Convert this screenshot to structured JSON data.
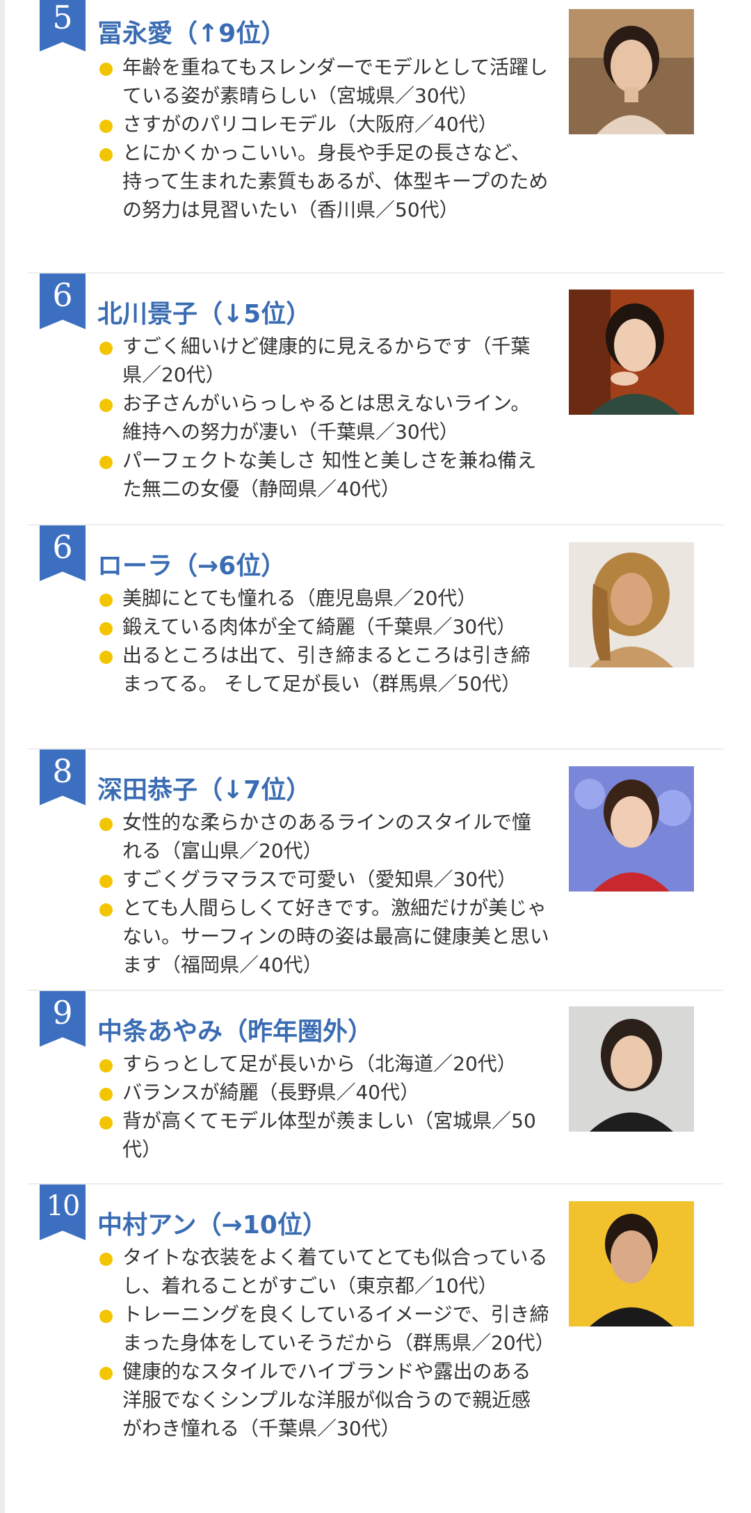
{
  "entries": [
    {
      "rank": "5",
      "name": "冨永愛（↑9位）",
      "comments": [
        "年齢を重ねてもスレンダーでモデルとして活躍している姿が素晴らしい（宮城県／30代）",
        "さすがのパリコレモデル（大阪府／40代）",
        "とにかくかっこいい。身長や手足の長さなど、持って生まれた素質もあるが、体型キープのための努力は見習いたい（香川県／50代）"
      ]
    },
    {
      "rank": "6",
      "name": "北川景子（↓5位）",
      "comments": [
        "すごく細いけど健康的に見えるからです（千葉県／20代）",
        "お子さんがいらっしゃるとは思えないライン。維持への努力が凄い（千葉県／30代）",
        "パーフェクトな美しさ 知性と美しさを兼ね備えた無二の女優（静岡県／40代）"
      ]
    },
    {
      "rank": "6",
      "name": "ローラ（→6位）",
      "comments": [
        "美脚にとても憧れる（鹿児島県／20代）",
        "鍛えている肉体が全て綺麗（千葉県／30代）",
        "出るところは出て、引き締まるところは引き締まってる。 そして足が長い（群馬県／50代）"
      ]
    },
    {
      "rank": "8",
      "name": "深田恭子（↓7位）",
      "comments": [
        "女性的な柔らかさのあるラインのスタイルで憧れる（富山県／20代）",
        "すごくグラマラスで可愛い（愛知県／30代）",
        "とても人間らしくて好きです。激細だけが美じゃない。サーフィンの時の姿は最高に健康美と思います（福岡県／40代）"
      ]
    },
    {
      "rank": "9",
      "name": "中条あやみ（昨年圏外）",
      "comments": [
        "すらっとして足が長いから（北海道／20代）",
        "バランスが綺麗（長野県／40代）",
        "背が高くてモデル体型が羨ましい（宮城県／50代）"
      ]
    },
    {
      "rank": "10",
      "name": "中村アン（→10位）",
      "comments": [
        "タイトな衣装をよく着ていてとても似合っているし、着れることがすごい（東京都／10代）",
        "トレーニングを良くしているイメージで、引き締まった身体をしていそうだから（群馬県／20代）",
        "健康的なスタイルでハイブランドや露出のある洋服でなくシンプルな洋服が似合うので親近感がわき憧れる（千葉県／30代）"
      ]
    }
  ],
  "colors": {
    "badge": "#3d6fc0",
    "name": "#3a6cb3",
    "bullet": "#f2c500",
    "text": "#333333",
    "divider": "#ededed"
  }
}
